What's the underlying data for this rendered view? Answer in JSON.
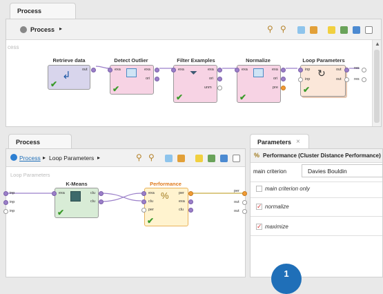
{
  "top": {
    "tab_label": "Process",
    "breadcrumb": "Process",
    "canvas_partial_label": "cess",
    "operators": [
      {
        "label": "Retrieve data",
        "ports_out": [
          "out"
        ]
      },
      {
        "label": "Detect Outlier",
        "ports_in": [
          "exa"
        ],
        "ports_out": [
          "exa",
          "ori"
        ]
      },
      {
        "label": "Filter Examples",
        "ports_in": [
          "exa"
        ],
        "ports_out": [
          "exa",
          "ori",
          "unm"
        ]
      },
      {
        "label": "Normalize",
        "ports_in": [
          "exa"
        ],
        "ports_out": [
          "exa",
          "ori",
          "pre"
        ]
      },
      {
        "label": "Loop Parameters",
        "ports_in": [
          "inp",
          "inp"
        ],
        "ports_out": [
          "out",
          "out"
        ]
      }
    ],
    "res_labels": [
      "res",
      "res"
    ]
  },
  "bottom": {
    "tab_label": "Process",
    "breadcrumb_link": "Process",
    "breadcrumb_current": "Loop Parameters",
    "canvas_label": "Loop Parameters",
    "left_ports": [
      "inp",
      "inp",
      "inp"
    ],
    "right_ports": [
      "per",
      "out",
      "out"
    ],
    "kmeans": {
      "label": "K-Means",
      "ports_in": [
        "exa"
      ],
      "ports_out": [
        "clu",
        "clu"
      ]
    },
    "performance": {
      "label": "Performance",
      "ports_in": [
        "exa",
        "clu",
        "per"
      ],
      "ports_out": [
        "per",
        "exa",
        "clu"
      ]
    }
  },
  "parameters": {
    "tab_label": "Parameters",
    "close_glyph": "×",
    "operator_title": "Performance (Cluster Distance Performance)",
    "main_criterion_label": "main criterion",
    "main_criterion_value": "Davies Bouldin",
    "checkboxes": [
      {
        "label": "main criterion only",
        "checked": false
      },
      {
        "label": "normalize",
        "checked": true
      },
      {
        "label": "maximize",
        "checked": true
      }
    ],
    "check_glyph": "✓"
  },
  "badge": "1",
  "colors": {
    "accent": "#1f6fb8",
    "badge": "#1f6fb8"
  }
}
